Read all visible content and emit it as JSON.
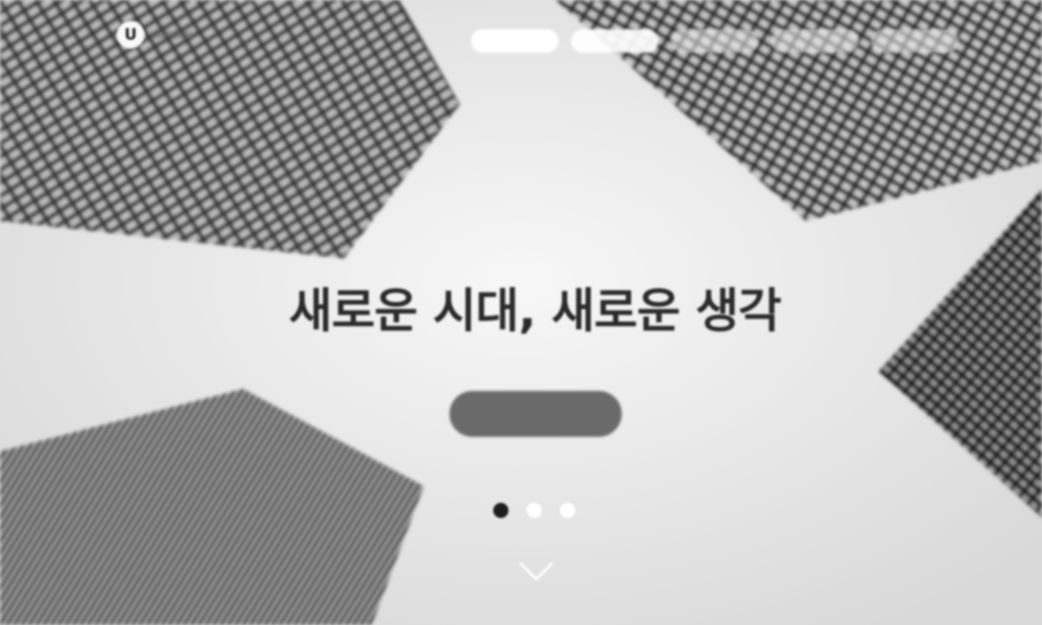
{
  "header": {
    "logo": {
      "mark": "U"
    },
    "nav": {
      "items": [
        {
          "label": ""
        },
        {
          "label": ""
        },
        {
          "label": ""
        },
        {
          "label": ""
        },
        {
          "label": ""
        }
      ]
    }
  },
  "hero": {
    "title": "새로운 시대, 새로운 생각",
    "subtitle": "",
    "cta_label": ""
  },
  "slider": {
    "total_slides": 3,
    "active_index": 0
  },
  "icons": {
    "logo": "circle-u-logo-icon",
    "scroll": "chevron-down-icon"
  },
  "colors": {
    "background": "#e9e9e9",
    "title": "#2a2a2a",
    "cta_background": "#6a6a6a",
    "active_dot": "#1c1c1c",
    "inactive_dot": "#ffffff"
  }
}
